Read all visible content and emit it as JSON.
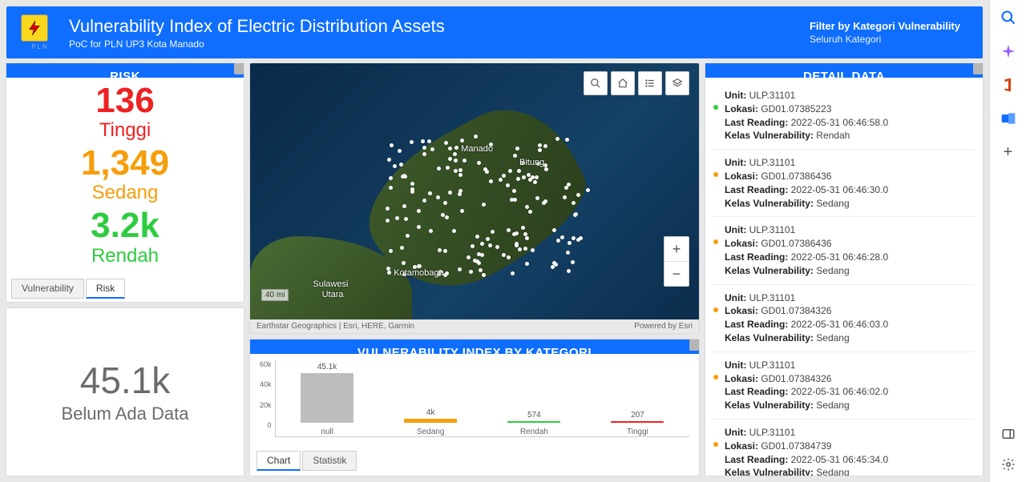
{
  "header": {
    "title": "Vulnerability Index of Electric Distribution Assets",
    "subtitle": "PoC for PLN UP3 Kota Manado",
    "logo_text": "PLN",
    "filter_label": "Filter by Kategori Vulnerability",
    "filter_value": "Seluruh Kategori"
  },
  "risk": {
    "title": "RISK",
    "items": [
      {
        "value": "136",
        "label": "Tinggi",
        "color": "red"
      },
      {
        "value": "1,349",
        "label": "Sedang",
        "color": "orange"
      },
      {
        "value": "3.2k",
        "label": "Rendah",
        "color": "green"
      }
    ],
    "tabs": {
      "vuln": "Vulnerability",
      "risk": "Risk"
    }
  },
  "nodata": {
    "value": "45.1k",
    "label": "Belum Ada Data"
  },
  "map": {
    "scale": "40 mi",
    "attrib_left": "Earthstar Geographics | Esri, HERE, Garmin",
    "attrib_right": "Powered by Esri",
    "cities": {
      "manado": "Manado",
      "bitung": "Bitung",
      "kotamobagu": "Kotamobagu",
      "sulawesi": "Sulawesi",
      "utara": "Utara"
    }
  },
  "chart_card": {
    "title": "VULNERABILITY INDEX BY KATEGORI",
    "tabs": {
      "chart": "Chart",
      "stat": "Statistik"
    }
  },
  "chart_data": {
    "type": "bar",
    "categories": [
      "null",
      "Sedang",
      "Rendah",
      "Tinggi"
    ],
    "values": [
      45100,
      4000,
      574,
      207
    ],
    "display_values": [
      "45.1k",
      "4k",
      "574",
      "207"
    ],
    "colors": [
      "#bdbdbd",
      "#f59e0b",
      "#2ecc40",
      "#e22"
    ],
    "title": "VULNERABILITY INDEX BY KATEGORI",
    "xlabel": "",
    "ylabel": "",
    "ylim": [
      0,
      60000
    ],
    "yticks": [
      "60k",
      "40k",
      "20k",
      "0"
    ]
  },
  "detail": {
    "title": "DETAIL DATA",
    "labels": {
      "unit": "Unit:",
      "lokasi": "Lokasi:",
      "last": "Last Reading:",
      "kelas": "Kelas Vulnerability:"
    },
    "items": [
      {
        "dot": "green",
        "unit": "ULP.31101",
        "lokasi": "GD01.07385223",
        "last": "2022-05-31 06:46:58.0",
        "kelas": "Rendah"
      },
      {
        "dot": "orange",
        "unit": "ULP.31101",
        "lokasi": "GD01.07386436",
        "last": "2022-05-31 06:46:30.0",
        "kelas": "Sedang"
      },
      {
        "dot": "orange",
        "unit": "ULP.31101",
        "lokasi": "GD01.07386436",
        "last": "2022-05-31 06:46:28.0",
        "kelas": "Sedang"
      },
      {
        "dot": "orange",
        "unit": "ULP.31101",
        "lokasi": "GD01.07384326",
        "last": "2022-05-31 06:46:03.0",
        "kelas": "Sedang"
      },
      {
        "dot": "orange",
        "unit": "ULP.31101",
        "lokasi": "GD01.07384326",
        "last": "2022-05-31 06:46:02.0",
        "kelas": "Sedang"
      },
      {
        "dot": "orange",
        "unit": "ULP.31101",
        "lokasi": "GD01.07384739",
        "last": "2022-05-31 06:45:34.0",
        "kelas": "Sedang"
      }
    ]
  }
}
